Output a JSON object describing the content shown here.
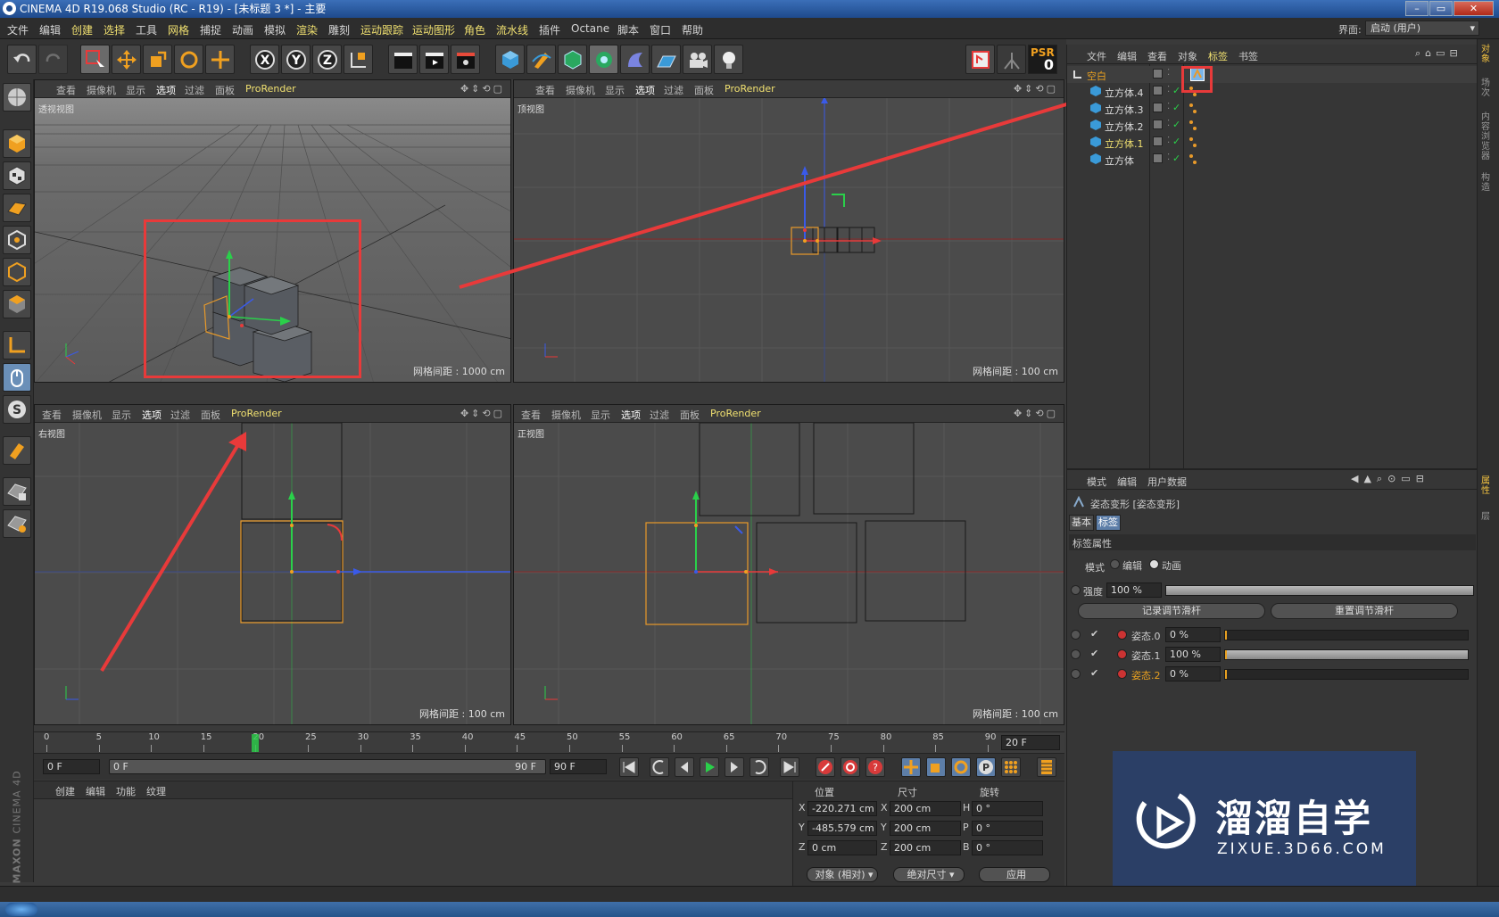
{
  "window": {
    "title": "CINEMA 4D R19.068 Studio (RC - R19) - [未标题 3 *] - 主要"
  },
  "menu": [
    "文件",
    "编辑",
    "创建",
    "选择",
    "工具",
    "网格",
    "捕捉",
    "动画",
    "模拟",
    "渲染",
    "雕刻",
    "运动跟踪",
    "运动图形",
    "角色",
    "流水线",
    "插件",
    "Octane",
    "脚本",
    "窗口",
    "帮助"
  ],
  "layout": {
    "label": "界面:",
    "value": "启动 (用户)"
  },
  "toolbar": {
    "axis_x": "X",
    "axis_y": "Y",
    "axis_z": "Z",
    "psr_label": "PSR",
    "psr_value": "0"
  },
  "viewport_menu": {
    "view": "查看",
    "camera": "摄像机",
    "display": "显示",
    "options": "选项",
    "filter": "过滤",
    "panel": "面板",
    "prorender": "ProRender"
  },
  "viewports": [
    {
      "label": "透视视图",
      "grid": "网格间距 : 1000 cm"
    },
    {
      "label": "顶视图",
      "grid": "网格间距 : 100 cm"
    },
    {
      "label": "右视图",
      "grid": "网格间距 : 100 cm"
    },
    {
      "label": "正视图",
      "grid": "网格间距 : 100 cm"
    }
  ],
  "axes": {
    "x": "X",
    "y": "Y",
    "z": "Z"
  },
  "timeline": {
    "ticks": [
      "0",
      "5",
      "10",
      "15",
      "20",
      "25",
      "30",
      "35",
      "40",
      "45",
      "50",
      "55",
      "60",
      "65",
      "70",
      "75",
      "80",
      "85",
      "90"
    ],
    "current_frame": 20,
    "end_field": "20 F"
  },
  "transport": {
    "start": "0 F",
    "range_start": "0 F",
    "range_end": "90 F",
    "end": "90 F"
  },
  "material_menu": [
    "创建",
    "编辑",
    "功能",
    "纹理"
  ],
  "coords": {
    "header_pos": "位置",
    "header_size": "尺寸",
    "header_rot": "旋转",
    "rows": [
      {
        "axis": "X",
        "pos": "-220.271 cm",
        "saxis": "X",
        "size": "200 cm",
        "raxis": "H",
        "rot": "0 °"
      },
      {
        "axis": "Y",
        "pos": "-485.579 cm",
        "saxis": "Y",
        "size": "200 cm",
        "raxis": "P",
        "rot": "0 °"
      },
      {
        "axis": "Z",
        "pos": "0 cm",
        "saxis": "Z",
        "size": "200 cm",
        "raxis": "B",
        "rot": "0 °"
      }
    ],
    "mode": "对象 (相对)",
    "size_mode": "绝对尺寸",
    "apply": "应用"
  },
  "object_manager": {
    "menu": [
      "文件",
      "编辑",
      "查看",
      "对象",
      "标签",
      "书签"
    ],
    "objects": [
      {
        "name": "空白",
        "icon": "null-icon"
      },
      {
        "name": "立方体.4",
        "icon": "cube-icon"
      },
      {
        "name": "立方体.3",
        "icon": "cube-icon"
      },
      {
        "name": "立方体.2",
        "icon": "cube-icon"
      },
      {
        "name": "立方体.1",
        "icon": "cube-icon"
      },
      {
        "name": "立方体",
        "icon": "cube-icon"
      }
    ]
  },
  "attributes": {
    "menu": [
      "模式",
      "编辑",
      "用户数据"
    ],
    "title": "姿态变形 [姿态变形]",
    "tabs": [
      "基本",
      "标签"
    ],
    "section": "标签属性",
    "mode_label": "模式",
    "mode_edit": "编辑",
    "mode_anim": "动画",
    "strength_label": "强度",
    "strength_value": "100 %",
    "strength_fraction": 1.0,
    "btn_record": "记录调节滑杆",
    "btn_reset": "重置调节滑杆",
    "poses": [
      {
        "name": "姿态.0",
        "value": "0 %",
        "fraction": 0.0
      },
      {
        "name": "姿态.1",
        "value": "100 %",
        "fraction": 1.0
      },
      {
        "name": "姿态.2",
        "value": "0 %",
        "fraction": 0.0
      }
    ]
  },
  "right_tabs": [
    "对象",
    "场次",
    "内容浏览器",
    "构造",
    "属性",
    "层"
  ],
  "branding": {
    "maxon": "MAXON",
    "c4d": "CINEMA 4D"
  },
  "watermark": {
    "brand": "溜溜自学",
    "url": "ZIXUE.3D66.COM"
  },
  "colors": {
    "accent_red": "#e83a3a",
    "highlight_yellow": "#e8b84a",
    "selection_orange": "#e89a2a"
  }
}
